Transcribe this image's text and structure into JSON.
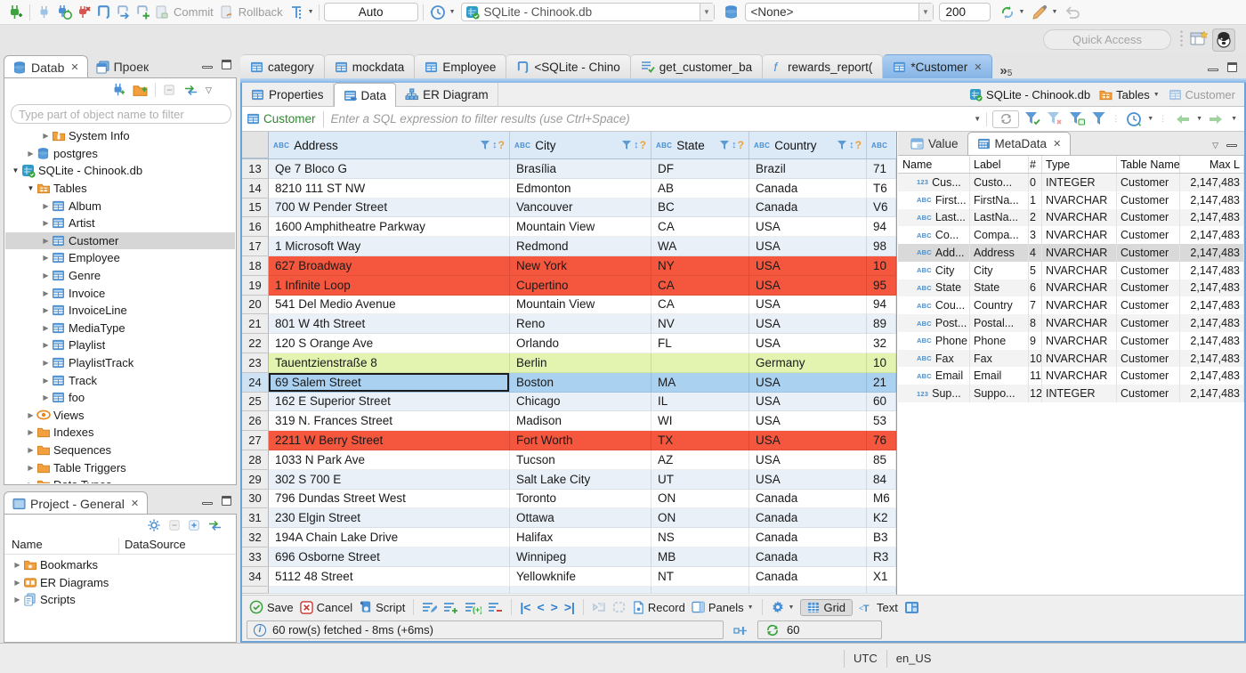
{
  "toolbar": {
    "commit_label": "Commit",
    "rollback_label": "Rollback",
    "txn_mode": "Auto",
    "datasource": "SQLite - Chinook.db",
    "schema": "<None>",
    "fetch_size": "200",
    "quick_access_placeholder": "Quick Access"
  },
  "sidebar": {
    "tab_database": "Datab",
    "tab_project": "Проек",
    "filter_placeholder": "Type part of object name to filter",
    "tree": [
      {
        "label": "System Info",
        "icon": "folder-info",
        "indent": 2,
        "expanded": false
      },
      {
        "label": "postgres",
        "icon": "database",
        "indent": 1,
        "expanded": false
      },
      {
        "label": "SQLite - Chinook.db",
        "icon": "database-sqlite",
        "indent": 0,
        "expanded": true
      },
      {
        "label": "Tables",
        "icon": "folder-tables",
        "indent": 1,
        "expanded": true
      },
      {
        "label": "Album",
        "icon": "table",
        "indent": 2,
        "expanded": false
      },
      {
        "label": "Artist",
        "icon": "table",
        "indent": 2,
        "expanded": false
      },
      {
        "label": "Customer",
        "icon": "table",
        "indent": 2,
        "expanded": false,
        "selected": true
      },
      {
        "label": "Employee",
        "icon": "table",
        "indent": 2,
        "expanded": false
      },
      {
        "label": "Genre",
        "icon": "table",
        "indent": 2,
        "expanded": false
      },
      {
        "label": "Invoice",
        "icon": "table",
        "indent": 2,
        "expanded": false
      },
      {
        "label": "InvoiceLine",
        "icon": "table",
        "indent": 2,
        "expanded": false
      },
      {
        "label": "MediaType",
        "icon": "table",
        "indent": 2,
        "expanded": false
      },
      {
        "label": "Playlist",
        "icon": "table",
        "indent": 2,
        "expanded": false
      },
      {
        "label": "PlaylistTrack",
        "icon": "table",
        "indent": 2,
        "expanded": false
      },
      {
        "label": "Track",
        "icon": "table",
        "indent": 2,
        "expanded": false
      },
      {
        "label": "foo",
        "icon": "table",
        "indent": 2,
        "expanded": false
      },
      {
        "label": "Views",
        "icon": "views",
        "indent": 1,
        "expanded": false
      },
      {
        "label": "Indexes",
        "icon": "folder",
        "indent": 1,
        "expanded": false
      },
      {
        "label": "Sequences",
        "icon": "folder",
        "indent": 1,
        "expanded": false
      },
      {
        "label": "Table Triggers",
        "icon": "folder",
        "indent": 1,
        "expanded": false
      },
      {
        "label": "Data Types",
        "icon": "folder",
        "indent": 1,
        "expanded": false
      }
    ]
  },
  "project_panel": {
    "title": "Project - General",
    "col_name": "Name",
    "col_datasource": "DataSource",
    "items": [
      {
        "label": "Bookmarks",
        "icon": "folder-bookmarks"
      },
      {
        "label": "ER Diagrams",
        "icon": "er-diagram"
      },
      {
        "label": "Scripts",
        "icon": "scripts"
      }
    ]
  },
  "editor_tabs": [
    {
      "label": "category",
      "icon": "table",
      "active": false
    },
    {
      "label": "mockdata",
      "icon": "table",
      "active": false
    },
    {
      "label": "Employee",
      "icon": "table",
      "active": false
    },
    {
      "label": "<SQLite - Chino",
      "icon": "sql-script",
      "active": false
    },
    {
      "label": "get_customer_ba",
      "icon": "view-check",
      "active": false
    },
    {
      "label": "rewards_report(",
      "icon": "function",
      "active": false
    },
    {
      "label": "*Customer",
      "icon": "table",
      "active": true
    }
  ],
  "tab_overflow_count": "5",
  "subtabs": {
    "properties": "Properties",
    "data": "Data",
    "er_diagram": "ER Diagram"
  },
  "breadcrumb": {
    "datasource": "SQLite - Chinook.db",
    "container": "Tables",
    "entity": "Customer"
  },
  "filter_bar": {
    "entity": "Customer",
    "placeholder": "Enter a SQL expression to filter results (use Ctrl+Space)"
  },
  "grid": {
    "columns": [
      "Address",
      "City",
      "State",
      "Country"
    ],
    "rows": [
      {
        "n": "13",
        "address": "Qe 7 Bloco G",
        "city": "Brasília",
        "state": "DF",
        "country": "Brazil",
        "extra": "71",
        "highlight": ""
      },
      {
        "n": "14",
        "address": "8210 111 ST NW",
        "city": "Edmonton",
        "state": "AB",
        "country": "Canada",
        "extra": "T6",
        "highlight": ""
      },
      {
        "n": "15",
        "address": "700 W Pender Street",
        "city": "Vancouver",
        "state": "BC",
        "country": "Canada",
        "extra": "V6",
        "highlight": ""
      },
      {
        "n": "16",
        "address": "1600 Amphitheatre Parkway",
        "city": "Mountain View",
        "state": "CA",
        "country": "USA",
        "extra": "94",
        "highlight": ""
      },
      {
        "n": "17",
        "address": "1 Microsoft Way",
        "city": "Redmond",
        "state": "WA",
        "country": "USA",
        "extra": "98",
        "highlight": ""
      },
      {
        "n": "18",
        "address": "627 Broadway",
        "city": "New York",
        "state": "NY",
        "country": "USA",
        "extra": "10",
        "highlight": "red"
      },
      {
        "n": "19",
        "address": "1 Infinite Loop",
        "city": "Cupertino",
        "state": "CA",
        "country": "USA",
        "extra": "95",
        "highlight": "red"
      },
      {
        "n": "20",
        "address": "541 Del Medio Avenue",
        "city": "Mountain View",
        "state": "CA",
        "country": "USA",
        "extra": "94",
        "highlight": ""
      },
      {
        "n": "21",
        "address": "801 W 4th Street",
        "city": "Reno",
        "state": "NV",
        "country": "USA",
        "extra": "89",
        "highlight": ""
      },
      {
        "n": "22",
        "address": "120 S Orange Ave",
        "city": "Orlando",
        "state": "FL",
        "country": "USA",
        "extra": "32",
        "highlight": ""
      },
      {
        "n": "23",
        "address": "Tauentzienstraße 8",
        "city": "Berlin",
        "state": "",
        "country": "Germany",
        "extra": "10",
        "highlight": "green"
      },
      {
        "n": "24",
        "address": "69 Salem Street",
        "city": "Boston",
        "state": "MA",
        "country": "USA",
        "extra": "21",
        "highlight": "selected",
        "focused_cell": "address"
      },
      {
        "n": "25",
        "address": "162 E Superior Street",
        "city": "Chicago",
        "state": "IL",
        "country": "USA",
        "extra": "60",
        "highlight": ""
      },
      {
        "n": "26",
        "address": "319 N. Frances Street",
        "city": "Madison",
        "state": "WI",
        "country": "USA",
        "extra": "53",
        "highlight": ""
      },
      {
        "n": "27",
        "address": "2211 W Berry Street",
        "city": "Fort Worth",
        "state": "TX",
        "country": "USA",
        "extra": "76",
        "highlight": "red"
      },
      {
        "n": "28",
        "address": "1033 N Park Ave",
        "city": "Tucson",
        "state": "AZ",
        "country": "USA",
        "extra": "85",
        "highlight": ""
      },
      {
        "n": "29",
        "address": "302 S 700 E",
        "city": "Salt Lake City",
        "state": "UT",
        "country": "USA",
        "extra": "84",
        "highlight": ""
      },
      {
        "n": "30",
        "address": "796 Dundas Street West",
        "city": "Toronto",
        "state": "ON",
        "country": "Canada",
        "extra": "M6",
        "highlight": ""
      },
      {
        "n": "31",
        "address": "230 Elgin Street",
        "city": "Ottawa",
        "state": "ON",
        "country": "Canada",
        "extra": "K2",
        "highlight": ""
      },
      {
        "n": "32",
        "address": "194A Chain Lake Drive",
        "city": "Halifax",
        "state": "NS",
        "country": "Canada",
        "extra": "B3",
        "highlight": ""
      },
      {
        "n": "33",
        "address": "696 Osborne Street",
        "city": "Winnipeg",
        "state": "MB",
        "country": "Canada",
        "extra": "R3",
        "highlight": ""
      },
      {
        "n": "34",
        "address": "5112 48 Street",
        "city": "Yellowknife",
        "state": "NT",
        "country": "Canada",
        "extra": "X1",
        "highlight": ""
      }
    ]
  },
  "meta_panel": {
    "tab_value": "Value",
    "tab_metadata": "MetaData",
    "columns": {
      "name": "Name",
      "label": "Label",
      "num": "#",
      "type": "Type",
      "table": "Table Name",
      "max": "Max L"
    },
    "rows": [
      {
        "kind": "123",
        "name": "Cus...",
        "label": "Custo...",
        "num": "0",
        "type": "INTEGER",
        "table": "Customer",
        "max": "2,147,483"
      },
      {
        "kind": "ABC",
        "name": "First...",
        "label": "FirstNa...",
        "num": "1",
        "type": "NVARCHAR",
        "table": "Customer",
        "max": "2,147,483"
      },
      {
        "kind": "ABC",
        "name": "Last...",
        "label": "LastNa...",
        "num": "2",
        "type": "NVARCHAR",
        "table": "Customer",
        "max": "2,147,483"
      },
      {
        "kind": "ABC",
        "name": "Co...",
        "label": "Compa...",
        "num": "3",
        "type": "NVARCHAR",
        "table": "Customer",
        "max": "2,147,483"
      },
      {
        "kind": "ABC",
        "name": "Add...",
        "label": "Address",
        "num": "4",
        "type": "NVARCHAR",
        "table": "Customer",
        "max": "2,147,483",
        "selected": true
      },
      {
        "kind": "ABC",
        "name": "City",
        "label": "City",
        "num": "5",
        "type": "NVARCHAR",
        "table": "Customer",
        "max": "2,147,483"
      },
      {
        "kind": "ABC",
        "name": "State",
        "label": "State",
        "num": "6",
        "type": "NVARCHAR",
        "table": "Customer",
        "max": "2,147,483"
      },
      {
        "kind": "ABC",
        "name": "Cou...",
        "label": "Country",
        "num": "7",
        "type": "NVARCHAR",
        "table": "Customer",
        "max": "2,147,483"
      },
      {
        "kind": "ABC",
        "name": "Post...",
        "label": "Postal...",
        "num": "8",
        "type": "NVARCHAR",
        "table": "Customer",
        "max": "2,147,483"
      },
      {
        "kind": "ABC",
        "name": "Phone",
        "label": "Phone",
        "num": "9",
        "type": "NVARCHAR",
        "table": "Customer",
        "max": "2,147,483"
      },
      {
        "kind": "ABC",
        "name": "Fax",
        "label": "Fax",
        "num": "10",
        "type": "NVARCHAR",
        "table": "Customer",
        "max": "2,147,483"
      },
      {
        "kind": "ABC",
        "name": "Email",
        "label": "Email",
        "num": "11",
        "type": "NVARCHAR",
        "table": "Customer",
        "max": "2,147,483"
      },
      {
        "kind": "123",
        "name": "Sup...",
        "label": "Suppo...",
        "num": "12",
        "type": "INTEGER",
        "table": "Customer",
        "max": "2,147,483"
      }
    ]
  },
  "bottom_toolbar": {
    "save": "Save",
    "cancel": "Cancel",
    "script": "Script",
    "record": "Record",
    "panels": "Panels",
    "grid": "Grid",
    "text": "Text"
  },
  "result_status": {
    "message": "60 row(s) fetched - 8ms (+6ms)",
    "auto_refresh": "60"
  },
  "status_bar": {
    "timezone": "UTC",
    "locale": "en_US"
  }
}
